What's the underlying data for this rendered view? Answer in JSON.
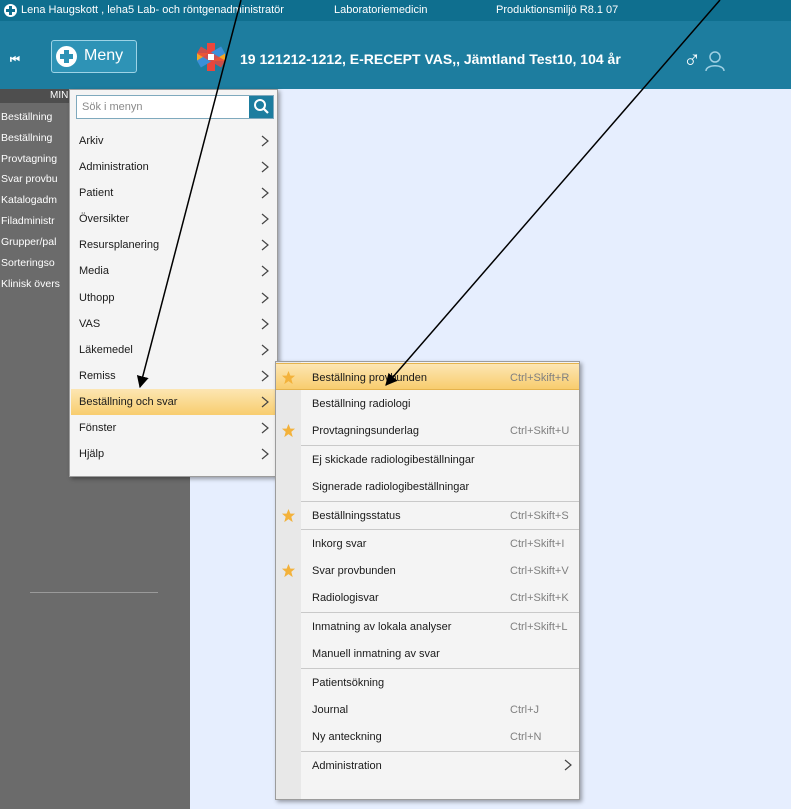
{
  "window": {
    "title_user": "Lena Haugskott , leha5 Lab- och röntgenadministratör",
    "title_unit": "Laboratoriemedicin",
    "title_env": "Produktionsmiljö R8.1 07"
  },
  "header": {
    "collapse_glyph": "⏮",
    "menu_label": "Meny",
    "patient_text": "19 121212-1212,  E-RECEPT VAS,, Jämtland Test10,  104 år",
    "gender_symbol": "♂",
    "accent_color": "#1d7d9f"
  },
  "sidebar": {
    "heading": "MIN",
    "items": [
      "Beställning",
      "Beställning",
      "Provtagning",
      "Svar provbu",
      "Katalogadm",
      "Filadministr",
      "Grupper/pal",
      "Sorteringso",
      "Klinisk övers"
    ]
  },
  "main_menu": {
    "search_placeholder": "Sök i menyn",
    "items": [
      {
        "label": "Arkiv",
        "has_submenu": true
      },
      {
        "label": "Administration",
        "has_submenu": true
      },
      {
        "label": "Patient",
        "has_submenu": true
      },
      {
        "label": "Översikter",
        "has_submenu": true
      },
      {
        "label": "Resursplanering",
        "has_submenu": true
      },
      {
        "label": "Media",
        "has_submenu": true
      },
      {
        "label": "Uthopp",
        "has_submenu": true
      },
      {
        "label": "VAS",
        "has_submenu": true
      },
      {
        "label": "Läkemedel",
        "has_submenu": true
      },
      {
        "label": "Remiss",
        "has_submenu": true
      },
      {
        "label": "Beställning och svar",
        "has_submenu": true,
        "active": true
      },
      {
        "label": "Fönster",
        "has_submenu": true
      },
      {
        "label": "Hjälp",
        "has_submenu": true
      }
    ]
  },
  "submenu": {
    "items": [
      {
        "label": "Beställning provbunden",
        "shortcut": "Ctrl+Skift+R",
        "favorite": true,
        "active": true
      },
      {
        "label": "Beställning radiologi",
        "shortcut": "",
        "favorite": false
      },
      {
        "label": "Provtagningsunderlag",
        "shortcut": "Ctrl+Skift+U",
        "favorite": true
      },
      {
        "label": "Ej skickade radiologibeställningar",
        "shortcut": "",
        "favorite": false
      },
      {
        "label": "Signerade radiologibeställningar",
        "shortcut": "",
        "favorite": false
      },
      {
        "label": "Beställningsstatus",
        "shortcut": "Ctrl+Skift+S",
        "favorite": true
      },
      {
        "label": "Inkorg svar",
        "shortcut": "Ctrl+Skift+I",
        "favorite": false
      },
      {
        "label": "Svar provbunden",
        "shortcut": "Ctrl+Skift+V",
        "favorite": true
      },
      {
        "label": "Radiologisvar",
        "shortcut": "Ctrl+Skift+K",
        "favorite": false
      },
      {
        "label": "Inmatning av lokala analyser",
        "shortcut": "Ctrl+Skift+L",
        "favorite": false
      },
      {
        "label": "Manuell inmatning av svar",
        "shortcut": "",
        "favorite": false
      },
      {
        "label": "Patientsökning",
        "shortcut": "",
        "favorite": false
      },
      {
        "label": "Journal",
        "shortcut": "Ctrl+J",
        "favorite": false
      },
      {
        "label": "Ny anteckning",
        "shortcut": "Ctrl+N",
        "favorite": false
      },
      {
        "label": "Administration",
        "shortcut": "",
        "favorite": false,
        "has_submenu": true
      }
    ]
  },
  "colors": {
    "highlight": "#f8cd6e",
    "star": "#f3b23b",
    "work_area": "#e6eefe",
    "sidebar": "#6b6b6b"
  }
}
